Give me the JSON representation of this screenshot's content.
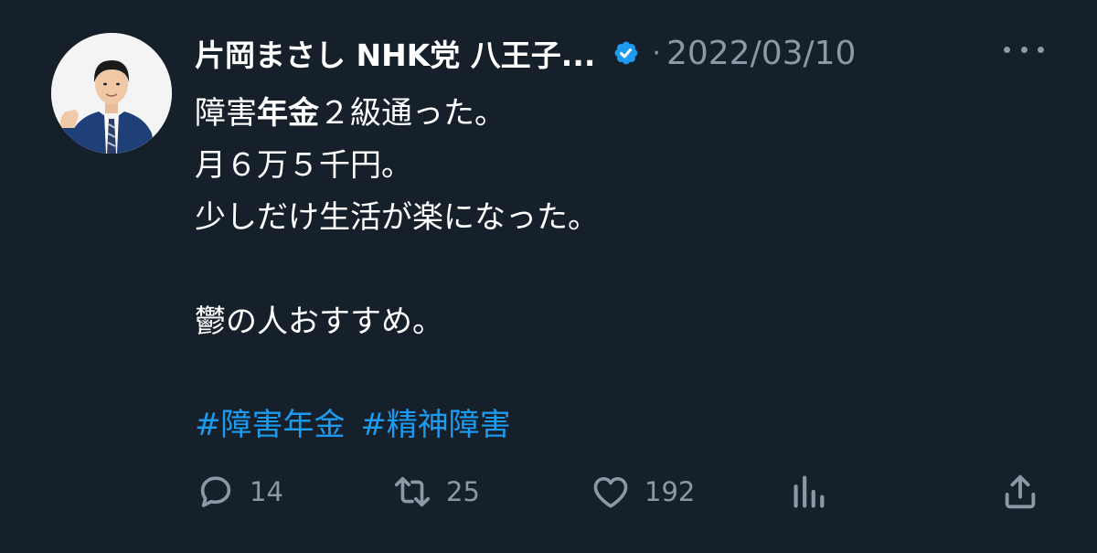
{
  "tweet": {
    "display_name": "片岡まさし NHK党 八王子...",
    "separator": "·",
    "date": "2022/03/10",
    "body": {
      "line1_pre": "障害",
      "line1_bold": "年金",
      "line1_post": "２級通った。",
      "line2": "月６万５千円。",
      "line3": "少しだけ生活が楽になった。",
      "line4": "",
      "line5": "鬱の人おすすめ。"
    },
    "hashtags": [
      "#障害年金",
      "#精神障害"
    ],
    "actions": {
      "reply_count": "14",
      "retweet_count": "25",
      "like_count": "192"
    }
  },
  "colors": {
    "background": "#15202b",
    "text": "#ffffff",
    "muted": "#8b98a5",
    "link": "#1d9bf0",
    "verified": "#1d9bf0"
  },
  "icons": {
    "verified": "verified-badge-icon",
    "more": "more-icon",
    "reply": "reply-icon",
    "retweet": "retweet-icon",
    "like": "heart-icon",
    "views": "bar-chart-icon",
    "share": "share-icon"
  }
}
